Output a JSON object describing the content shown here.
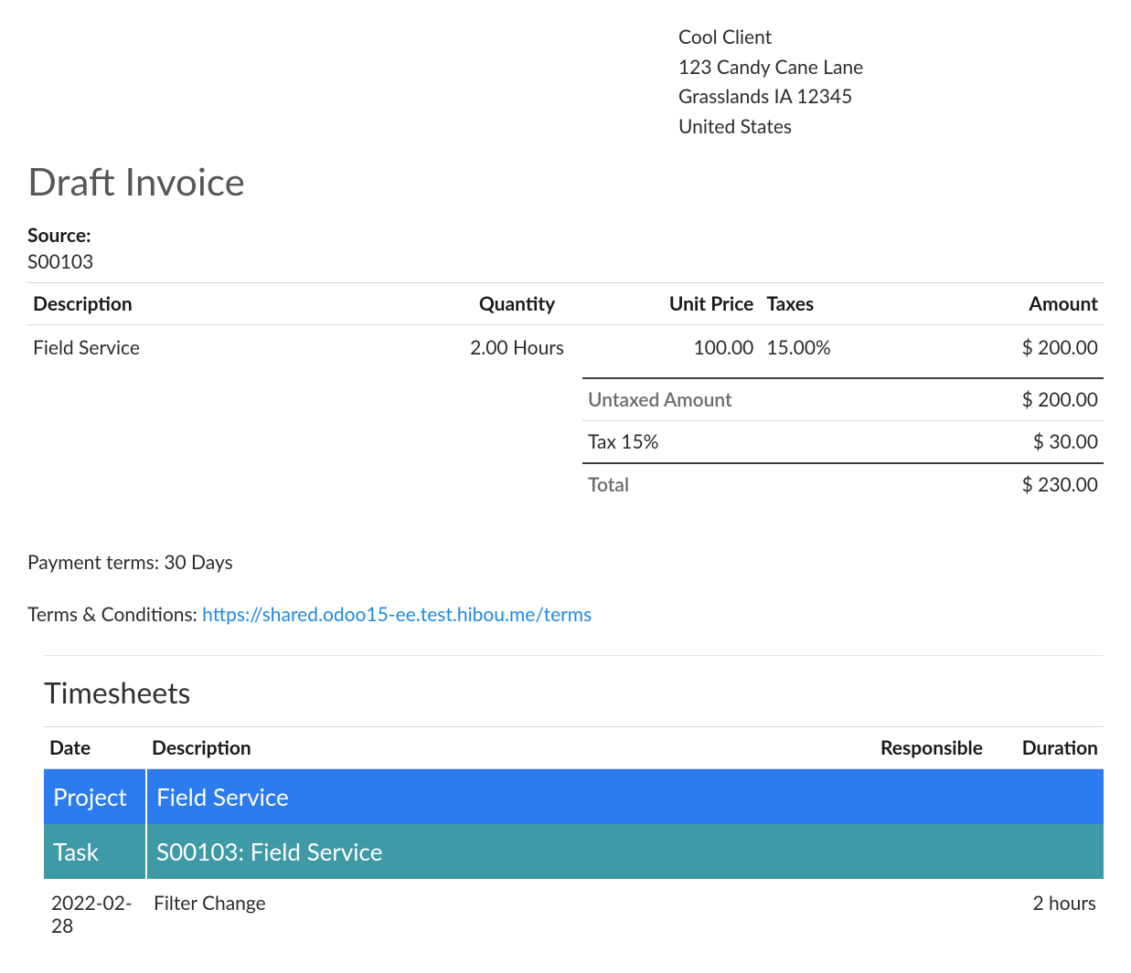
{
  "client": {
    "name": "Cool Client",
    "street": "123 Candy Cane Lane",
    "city_state_zip": "Grasslands IA 12345",
    "country": "United States"
  },
  "title": "Draft Invoice",
  "source_label": "Source:",
  "source_value": "S00103",
  "columns": {
    "description": "Description",
    "quantity": "Quantity",
    "unit_price": "Unit Price",
    "taxes": "Taxes",
    "amount": "Amount"
  },
  "line": {
    "description": "Field Service",
    "quantity": "2.00 Hours",
    "unit_price": "100.00",
    "taxes": "15.00%",
    "amount": "$ 200.00"
  },
  "totals": {
    "untaxed_label": "Untaxed Amount",
    "untaxed_value": "$ 200.00",
    "tax_label": "Tax 15%",
    "tax_value": "$ 30.00",
    "total_label": "Total",
    "total_value": "$ 230.00"
  },
  "payment_terms": "Payment terms: 30 Days",
  "terms_prefix": "Terms & Conditions: ",
  "terms_link": "https://shared.odoo15-ee.test.hibou.me/terms",
  "timesheets": {
    "title": "Timesheets",
    "columns": {
      "date": "Date",
      "description": "Description",
      "responsible": "Responsible",
      "duration": "Duration"
    },
    "project_label": "Project",
    "project_value": "Field Service",
    "task_label": "Task",
    "task_value": "S00103: Field Service",
    "entry": {
      "date": "2022-02-28",
      "description": "Filter Change",
      "responsible": "",
      "duration": "2 hours"
    }
  }
}
